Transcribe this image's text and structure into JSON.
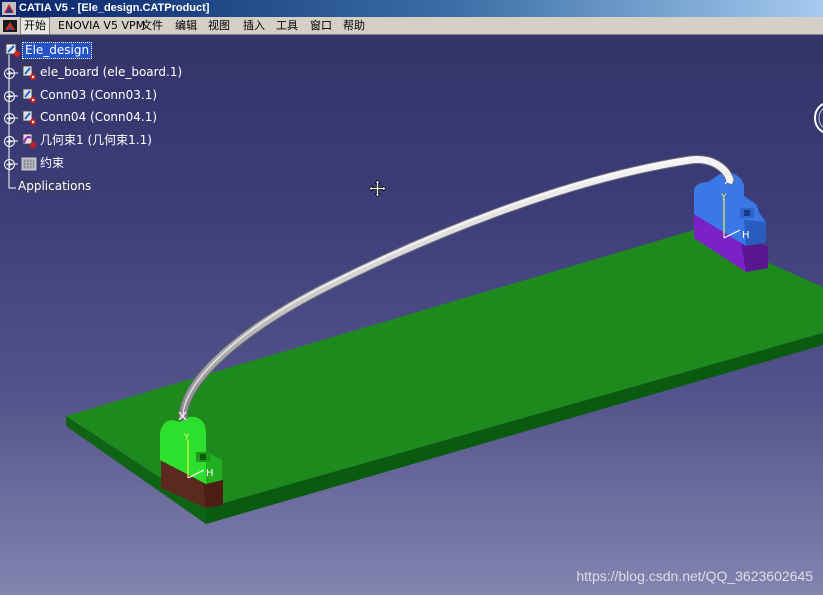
{
  "window": {
    "title": "CATIA V5 - [Ele_design.CATProduct]"
  },
  "menubar": {
    "items": [
      "开始",
      "ENOVIA V5 VPM",
      "文件",
      "编辑",
      "视图",
      "插入",
      "工具",
      "窗口",
      "帮助"
    ]
  },
  "tree": {
    "root": "Ele_design",
    "nodes": [
      {
        "label": "ele_board (ele_board.1)",
        "icon": "part-icon"
      },
      {
        "label": "Conn03 (Conn03.1)",
        "icon": "part-icon"
      },
      {
        "label": "Conn04 (Conn04.1)",
        "icon": "part-icon"
      },
      {
        "label": "几何束1 (几何束1.1)",
        "icon": "geometric-bundle-icon"
      },
      {
        "label": "约束",
        "icon": "constraints-icon"
      }
    ],
    "applications": "Applications"
  },
  "viewport": {
    "connector_axis_labels": {
      "vertical": "Y",
      "horizontal": "H"
    }
  },
  "watermark": "https://blog.csdn.net/QQ_3623602645",
  "colors": {
    "background_top": "#34346a",
    "background_bottom": "#8484b0",
    "board_top": "#1e8a1e",
    "board_side": "#0a5a10",
    "connector_left_top": "#2ee02e",
    "connector_left_base": "#5a2a1e",
    "connector_right_top": "#3a78e6",
    "connector_right_base": "#7a22c8",
    "bundle": "#d8d8d8",
    "tree_selection": "#2450c8"
  }
}
